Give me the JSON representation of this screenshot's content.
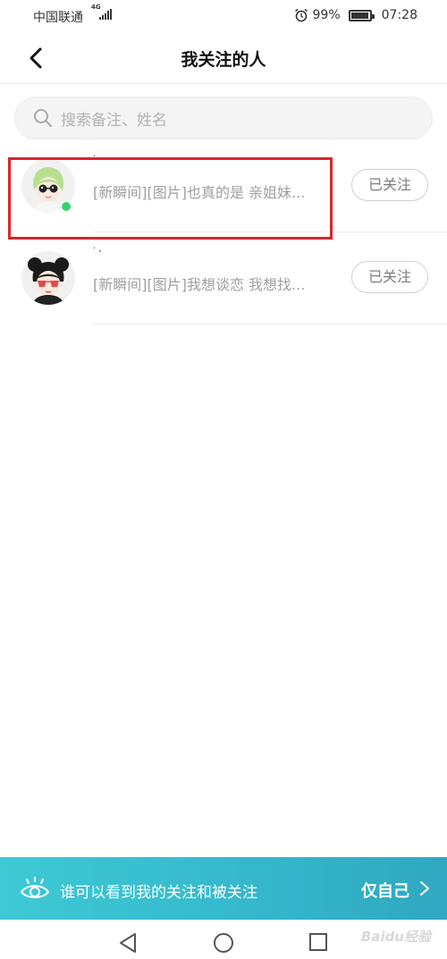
{
  "status_bar": {
    "carrier": "中国联通",
    "network": "4G",
    "battery": "99%",
    "battery_level": 0.99,
    "time": "07:28",
    "alarm_icon": "alarm-icon"
  },
  "header": {
    "title": "我关注的人",
    "back_icon": "back-chevron-icon"
  },
  "search": {
    "placeholder": "搜索备注、姓名",
    "icon": "search-icon"
  },
  "following": [
    {
      "name": "·",
      "preview": "[新瞬间][图片]也真的是 亲姐妹...",
      "button_label": "已关注",
      "online": true
    },
    {
      "name": "· ,",
      "preview": "[新瞬间][图片]我想谈恋 我想找...",
      "button_label": "已关注",
      "online": false
    }
  ],
  "privacy": {
    "label": "谁可以看到我的关注和被关注",
    "value": "仅自己",
    "icon": "eye-icon"
  },
  "system_nav": {
    "back": "nav-back-icon",
    "home": "nav-home-icon",
    "recents": "nav-recents-icon"
  },
  "watermark": "Baidu经验",
  "colors": {
    "accent": "#35b8cc",
    "online": "#37d16a",
    "highlight": "#d9262c"
  }
}
